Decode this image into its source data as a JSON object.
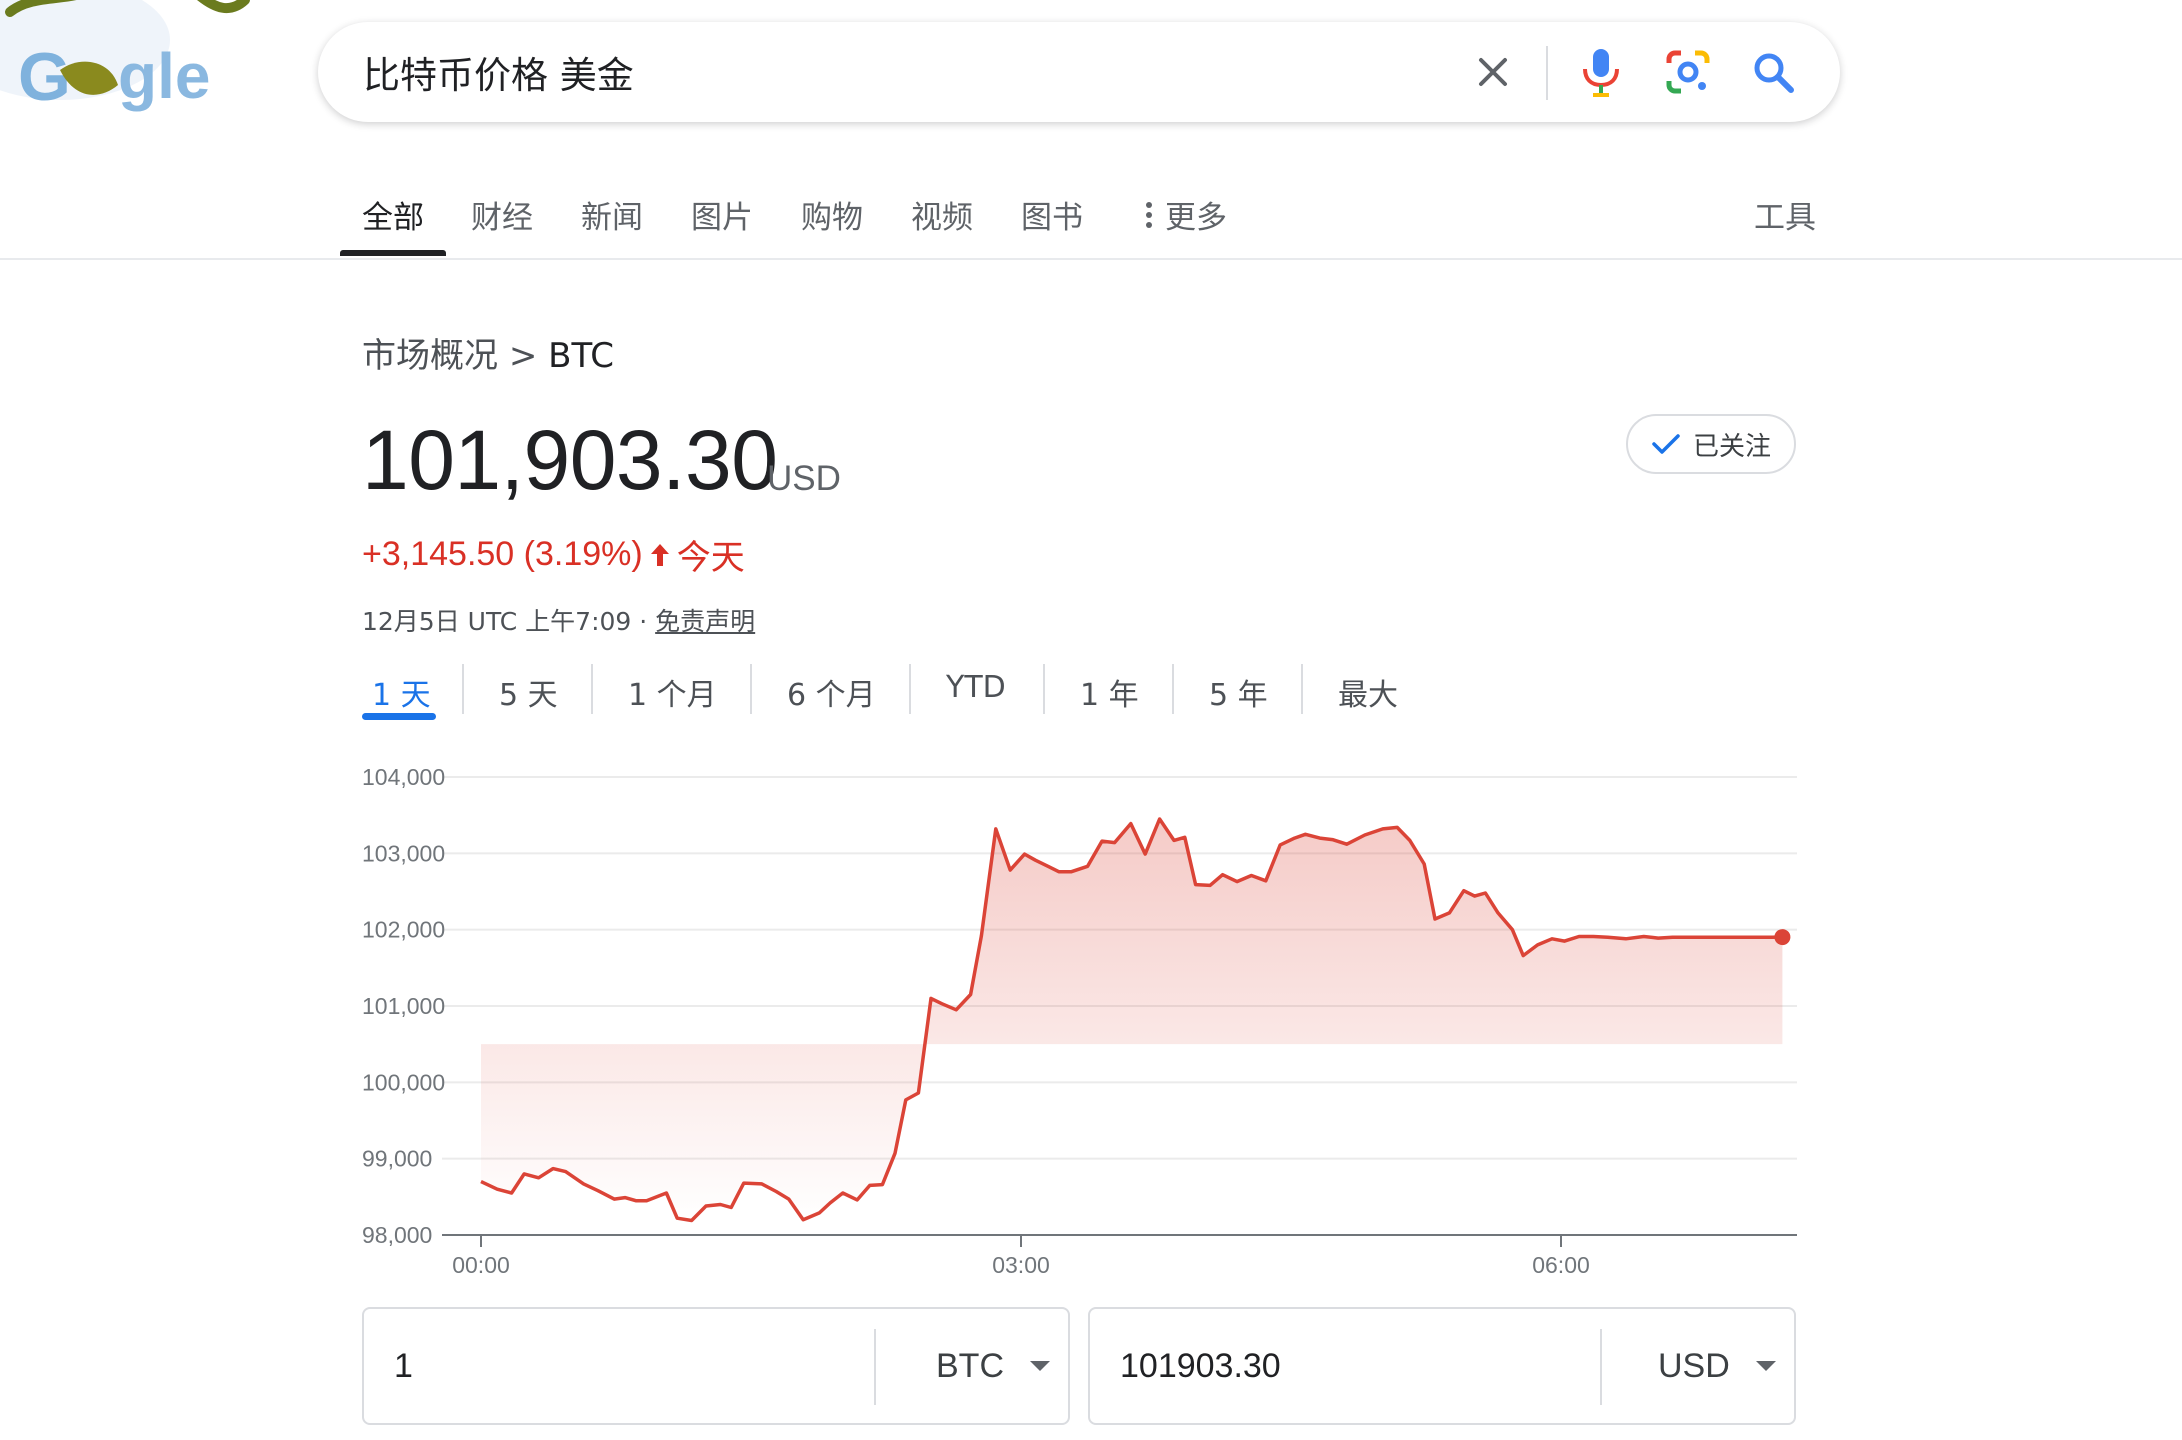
{
  "search": {
    "query": "比特币价格 美金"
  },
  "tabs": [
    {
      "label": "全部",
      "active": true
    },
    {
      "label": "财经"
    },
    {
      "label": "新闻"
    },
    {
      "label": "图片"
    },
    {
      "label": "购物"
    },
    {
      "label": "视频"
    },
    {
      "label": "图书"
    },
    {
      "label": "更多"
    }
  ],
  "tools_label": "工具",
  "breadcrumb": {
    "parent": "市场概况",
    "separator": ">",
    "current": "BTC"
  },
  "quote": {
    "price": "101,903.30",
    "currency": "USD",
    "change": "+3,145.50 (3.19%)",
    "period": "今天",
    "timestamp": "12月5日 UTC 上午7:09 · ",
    "disclaimer": "免责声明",
    "follow_label": "已关注",
    "change_color": "#d93025"
  },
  "ranges": [
    {
      "label": "1 天",
      "active": true
    },
    {
      "label": "5 天"
    },
    {
      "label": "1 个月"
    },
    {
      "label": "6 个月"
    },
    {
      "label": "YTD"
    },
    {
      "label": "1 年"
    },
    {
      "label": "5 年"
    },
    {
      "label": "最大"
    }
  ],
  "converter": {
    "from_amount": "1",
    "from_currency": "BTC",
    "to_amount": "101903.30",
    "to_currency": "USD"
  },
  "chart_data": {
    "type": "area",
    "y_ticks": [
      "104,000",
      "103,000",
      "102,000",
      "101,000",
      "100,000",
      "99,000",
      "98,000"
    ],
    "x_ticks": [
      {
        "label": "00:00",
        "hour": 0
      },
      {
        "label": "03:00",
        "hour": 3
      },
      {
        "label": "06:00",
        "hour": 6
      }
    ],
    "ylim": [
      98000,
      104000
    ],
    "xlim_hours": [
      0,
      7.25
    ],
    "grid": true,
    "line_color": "#db4437",
    "series": [
      {
        "x": [
          0.0,
          0.09,
          0.17,
          0.24,
          0.32,
          0.4,
          0.47,
          0.57,
          0.65,
          0.74,
          0.8,
          0.86,
          0.92,
          1.03,
          1.09,
          1.17,
          1.25,
          1.33,
          1.39,
          1.46,
          1.56,
          1.64,
          1.71,
          1.79,
          1.88,
          1.94,
          2.01,
          2.09,
          2.16,
          2.23,
          2.3,
          2.36,
          2.43,
          2.5,
          2.56,
          2.64,
          2.72,
          2.78,
          2.86,
          2.94,
          3.02,
          3.08,
          3.15,
          3.21,
          3.28,
          3.37,
          3.45,
          3.52,
          3.61,
          3.69,
          3.77,
          3.85,
          3.91,
          3.97,
          4.05,
          4.12,
          4.2,
          4.28,
          4.36,
          4.44,
          4.52,
          4.58,
          4.66,
          4.73,
          4.81,
          4.91,
          5.01,
          5.09,
          5.16,
          5.24,
          5.3,
          5.38,
          5.46,
          5.52,
          5.58,
          5.65,
          5.73,
          5.79,
          5.87,
          5.95,
          6.02,
          6.1,
          6.18,
          6.26,
          6.36,
          6.46,
          6.54,
          6.62,
          6.7,
          6.78,
          6.87,
          6.95,
          7.03,
          7.11,
          7.17,
          7.23
        ],
        "y": [
          98700,
          98600,
          98550,
          98800,
          98750,
          98870,
          98830,
          98670,
          98580,
          98470,
          98490,
          98450,
          98450,
          98550,
          98220,
          98190,
          98380,
          98400,
          98360,
          98680,
          98670,
          98570,
          98470,
          98200,
          98290,
          98420,
          98550,
          98460,
          98650,
          98660,
          99070,
          99770,
          99860,
          101100,
          101030,
          100950,
          101150,
          101920,
          103320,
          102780,
          102990,
          102910,
          102830,
          102760,
          102760,
          102830,
          103160,
          103140,
          103390,
          102990,
          103450,
          103170,
          103210,
          102590,
          102580,
          102720,
          102630,
          102710,
          102640,
          103110,
          103200,
          103250,
          103200,
          103180,
          103120,
          103240,
          103320,
          103340,
          103170,
          102860,
          102140,
          102220,
          102510,
          102440,
          102480,
          102220,
          102000,
          101660,
          101800,
          101880,
          101850,
          101910,
          101910,
          101900,
          101880,
          101910,
          101890,
          101900,
          101900,
          101900,
          101900,
          101900,
          101900,
          101900,
          101900,
          101903
        ]
      }
    ]
  }
}
